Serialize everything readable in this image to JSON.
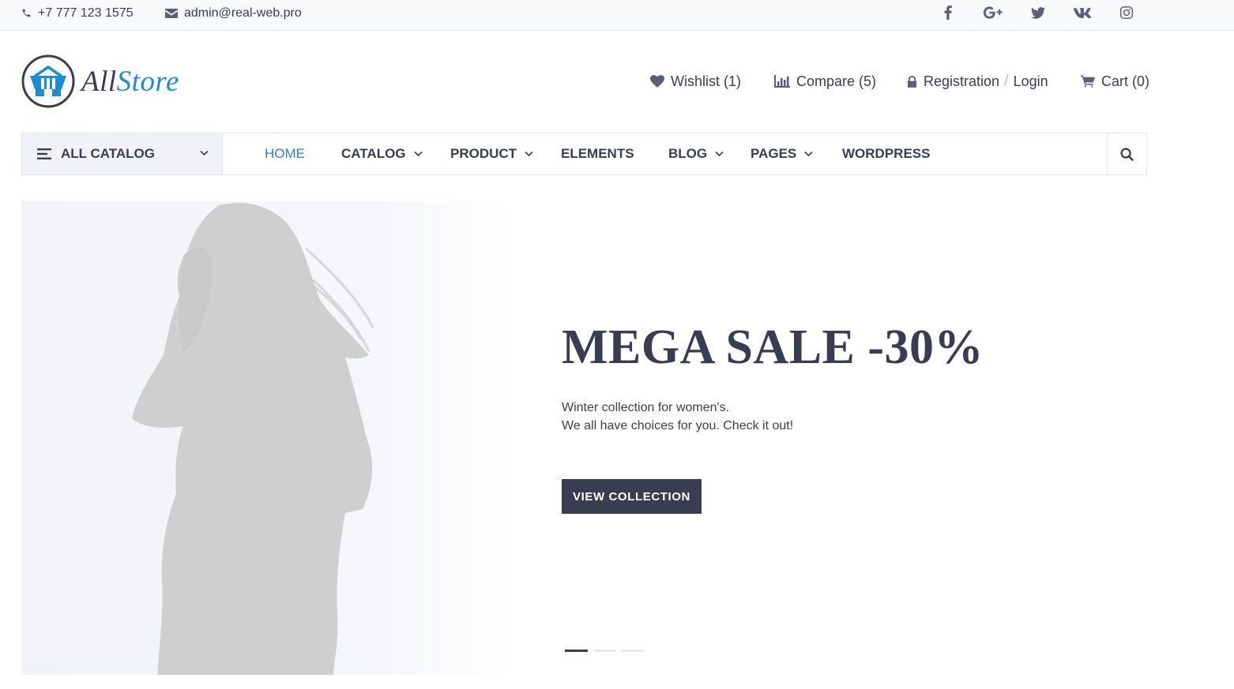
{
  "topbar": {
    "phone": "+7 777 123 1575",
    "email": "admin@real-web.pro",
    "social": [
      "facebook-icon",
      "google-plus-icon",
      "twitter-icon",
      "vk-icon",
      "instagram-icon"
    ]
  },
  "logo": {
    "part1": "All",
    "part2": "Store"
  },
  "header": {
    "wishlist": "Wishlist (1)",
    "compare": "Compare (5)",
    "registration": "Registration",
    "login": "Login",
    "cart": "Cart (0)"
  },
  "nav": {
    "catalog_button": "ALL CATALOG",
    "items": [
      "HOME",
      "CATALOG",
      "PRODUCT",
      "ELEMENTS",
      "BLOG",
      "PAGES",
      "WORDPRESS"
    ],
    "active": "HOME"
  },
  "hero": {
    "title": "MEGA SALE -30%",
    "line1": "Winter collection for women's.",
    "line2": "We all have choices for you. Check it out!",
    "button": "VIEW COLLECTION",
    "slides": 3,
    "active_slide": 1
  },
  "colors": {
    "primary": "#383d52",
    "accent": "#1f8cd1",
    "active_link": "#2b7fc4"
  }
}
